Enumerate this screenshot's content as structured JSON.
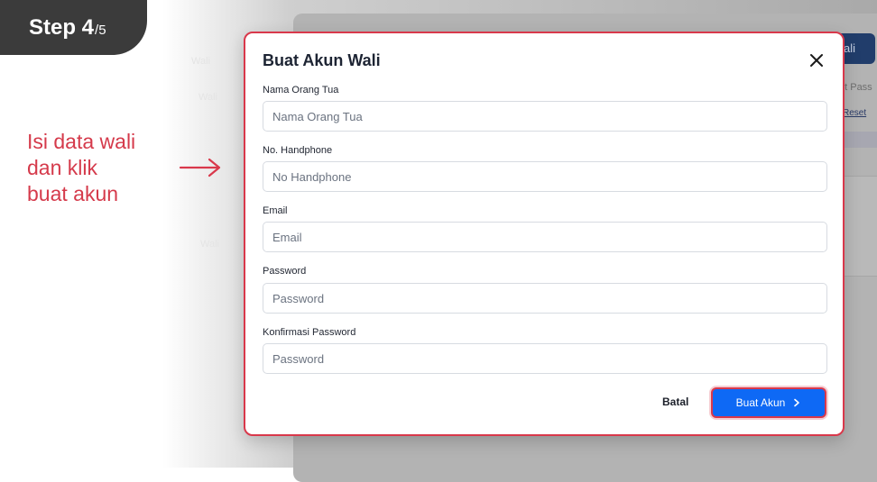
{
  "step": {
    "current": "Step 4",
    "total": "/5"
  },
  "instruction": {
    "lines": [
      "Isi data wali",
      "dan klik",
      "buat akun"
    ]
  },
  "background": {
    "button_label": "ali",
    "text_reset_password": "et Pass",
    "text_reset_link": "Reset",
    "faint_labels": [
      "Wali",
      "Wali",
      "Wali"
    ]
  },
  "modal": {
    "title": "Buat Akun Wali",
    "fields": [
      {
        "label": "Nama Orang Tua",
        "placeholder": "Nama Orang Tua"
      },
      {
        "label": "No. Handphone",
        "placeholder": "No Handphone"
      },
      {
        "label": "Email",
        "placeholder": "Email"
      },
      {
        "label": "Password",
        "placeholder": "Password"
      },
      {
        "label": "Konfirmasi Password",
        "placeholder": "Password"
      }
    ],
    "cancel_label": "Batal",
    "submit_label": "Buat Akun"
  },
  "colors": {
    "accent_red": "#d9384b",
    "primary_blue": "#0e69f5",
    "badge_bg": "#3b3b3b"
  }
}
